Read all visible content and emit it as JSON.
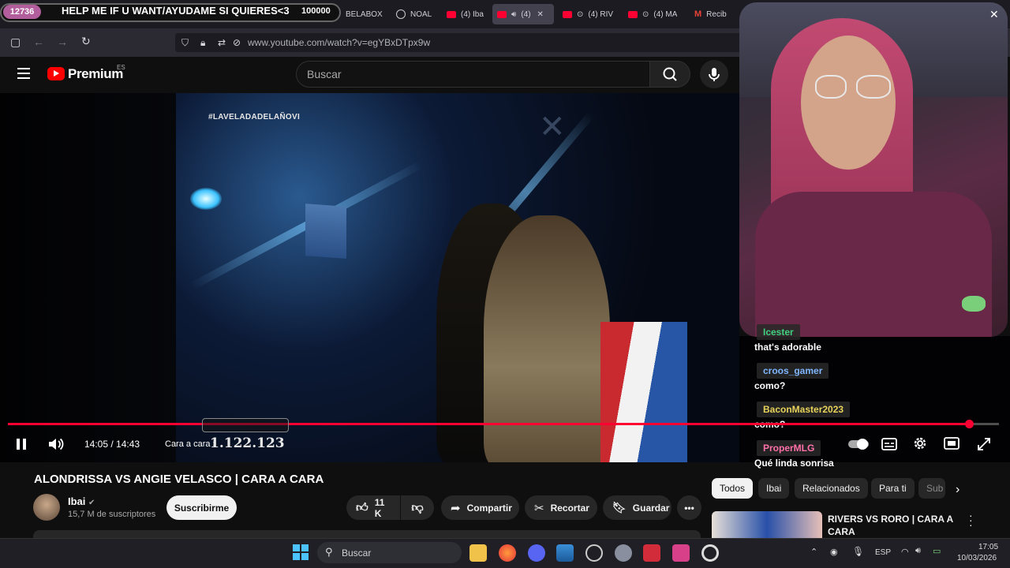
{
  "browser": {
    "tabs": [
      {
        "label": "BELABOX"
      },
      {
        "label": "NOAL"
      },
      {
        "label": "(4) Iba"
      },
      {
        "label": "(4)"
      },
      {
        "label": "(4) RIV"
      },
      {
        "label": "(4) MA"
      },
      {
        "label": "Recib"
      }
    ],
    "url": "www.youtube.com/watch?v=egYBxDTpx9w"
  },
  "stream_overlay": {
    "count": "12736",
    "banner_text": "HELP ME IF U WANT/AYUDAME SI QUIERES<3",
    "banner_number": "100000"
  },
  "youtube": {
    "logo_text": "Premium",
    "logo_region": "ES",
    "search_placeholder": "Buscar",
    "video": {
      "hashtag": "#LAVELADADELAÑOVI",
      "overlay_number": "1.122.123",
      "progress": 0.97
    },
    "player": {
      "time": "14:05 / 14:43",
      "chapter": "Cara a cara"
    },
    "title": "ALONDRISSA VS ANGIE VELASCO | CARA A CARA",
    "channel": {
      "name": "Ibai",
      "subscribers": "15,7 M de suscriptores"
    },
    "subscribe_label": "Suscribirme",
    "actions": {
      "likes": "11 K",
      "share": "Compartir",
      "clip": "Recortar",
      "save": "Guardar"
    },
    "chips": [
      "Todos",
      "Ibai",
      "Relacionados",
      "Para ti",
      "Sub"
    ],
    "recommended": [
      {
        "title": "RIVERS VS RORO | CARA A CARA"
      }
    ]
  },
  "chat": [
    {
      "user": "Icester",
      "message": "that's adorable",
      "color": "#3fd17f"
    },
    {
      "user": "croos_gamer",
      "message": "como?",
      "color": "#7fb6ff"
    },
    {
      "user": "BaconMaster2023",
      "message": "como?",
      "color": "#e8d35a"
    },
    {
      "user": "ProperMLG",
      "message": "Qué linda sonrisa",
      "color": "#ff6fa8"
    }
  ],
  "taskbar": {
    "search_placeholder": "Buscar",
    "language": "ESP",
    "time": "17:05",
    "date": "10/03/2026"
  },
  "colors": {
    "accent": "#ff0033",
    "background": "#0f0f0f"
  }
}
